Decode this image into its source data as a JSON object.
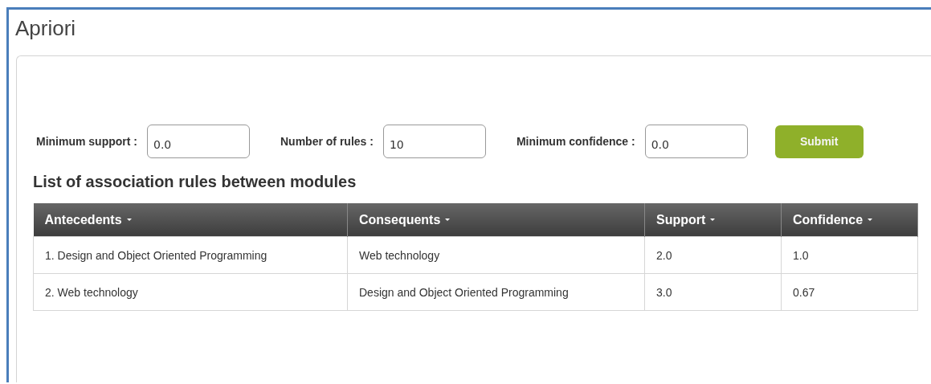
{
  "page": {
    "title": "Apriori"
  },
  "form": {
    "fields": [
      {
        "label": "Minimum support :",
        "value": "0.0"
      },
      {
        "label": "Number of rules :",
        "value": "10"
      },
      {
        "label": "Minimum confidence :",
        "value": "0.0"
      }
    ],
    "submit": "Submit"
  },
  "table": {
    "title": "List of association rules between modules",
    "columns": [
      "Antecedents",
      "Consequents",
      "Support",
      "Confidence"
    ],
    "rows": [
      [
        "1. Design and Object Oriented Programming",
        "Web technology",
        "2.0",
        "1.0"
      ],
      [
        "2. Web technology",
        "Design and Object Oriented Programming",
        "3.0",
        "0.67"
      ]
    ]
  }
}
